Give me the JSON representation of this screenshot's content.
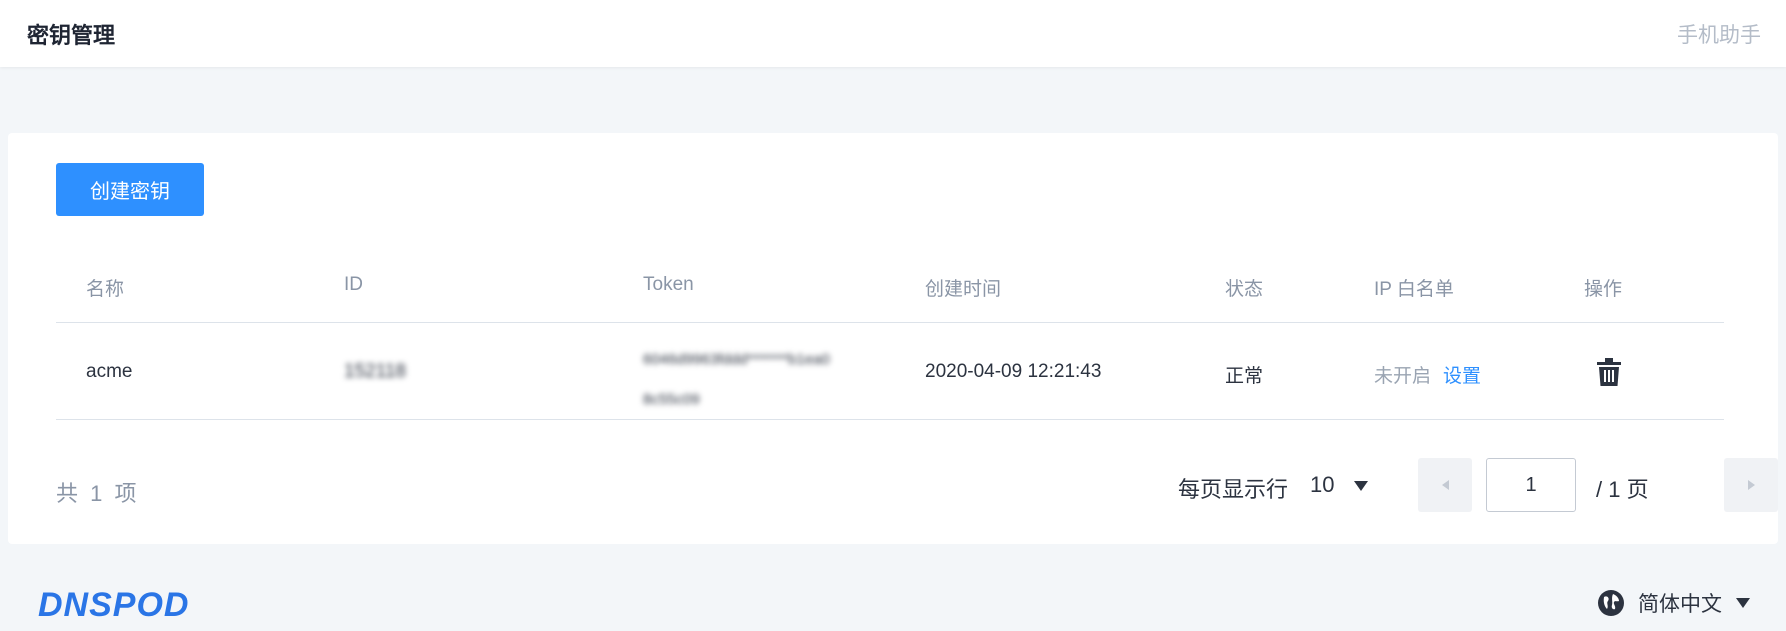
{
  "header": {
    "title": "密钥管理",
    "helper_link": "手机助手"
  },
  "toolbar": {
    "create_label": "创建密钥"
  },
  "table": {
    "columns": [
      "名称",
      "ID",
      "Token",
      "创建时间",
      "状态",
      "IP 白名单",
      "操作"
    ],
    "rows": [
      {
        "name": "acme",
        "id": "152118",
        "token_line1": "6046d9963fddd*******b1ea0",
        "token_line2": "8c55c09",
        "created": "2020-04-09 12:21:43",
        "status": "正常",
        "ip_status": "未开启",
        "ip_action": "设置",
        "op_icon": "trash-icon"
      }
    ]
  },
  "pagination": {
    "total_text": "共 1 项",
    "page_size_label": "每页显示行",
    "page_size": "10",
    "current_page": "1",
    "total_pages_text": "/ 1 页"
  },
  "footer": {
    "logo_text": "DNSPOD",
    "language": "简体中文"
  },
  "colors": {
    "accent": "#2e90ff",
    "background": "#f3f6f9",
    "logo": "#2a75e6"
  }
}
